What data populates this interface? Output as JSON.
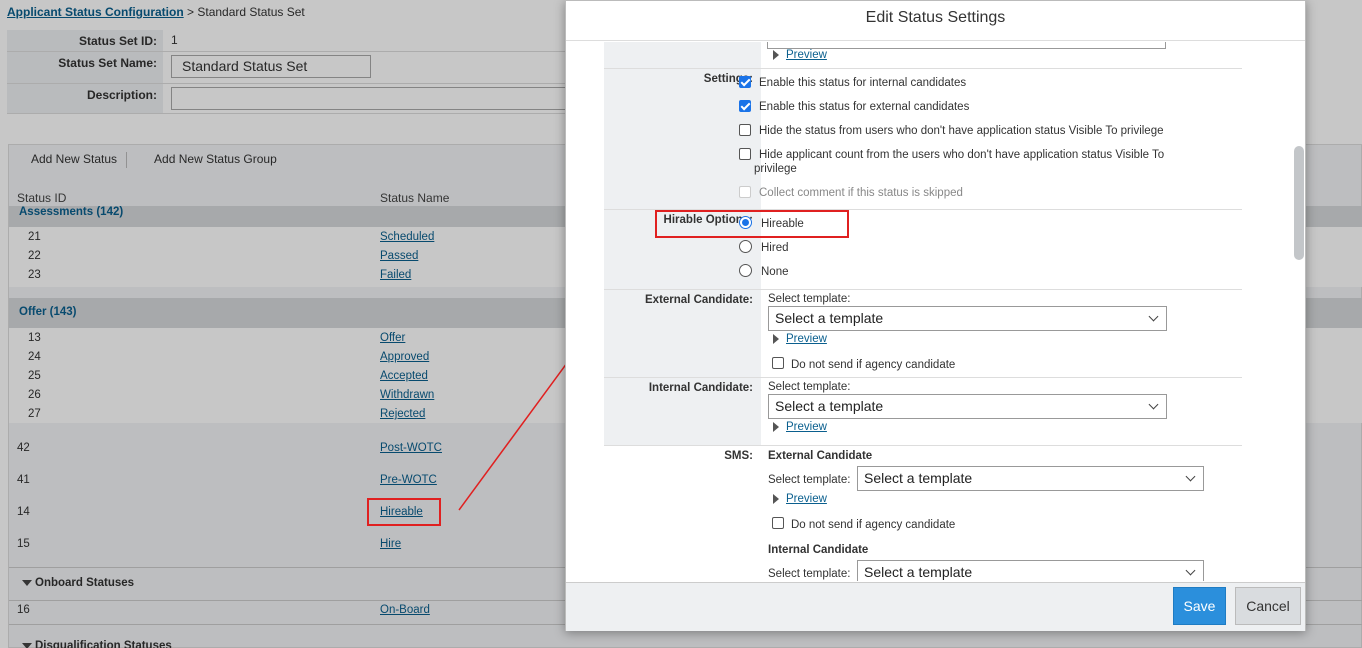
{
  "breadcrumb": {
    "link": "Applicant Status Configuration",
    "separator": " > ",
    "current": "Standard Status Set"
  },
  "status_set": {
    "id_label": "Status Set ID:",
    "id_value": "1",
    "name_label": "Status Set Name:",
    "name_value": "Standard Status Set",
    "desc_label": "Description:",
    "desc_value": ""
  },
  "toolbar": {
    "add_status": "Add New Status",
    "add_group": "Add New Status Group"
  },
  "columns": {
    "status_id": "Status ID",
    "status_name": "Status Name"
  },
  "groups": {
    "assessments": {
      "title": "Assessments (142)",
      "rows": [
        {
          "id": "21",
          "name": "Scheduled"
        },
        {
          "id": "22",
          "name": "Passed"
        },
        {
          "id": "23",
          "name": "Failed"
        }
      ]
    },
    "offer": {
      "title": "Offer (143)",
      "rows": [
        {
          "id": "13",
          "name": "Offer"
        },
        {
          "id": "24",
          "name": "Approved"
        },
        {
          "id": "25",
          "name": "Accepted"
        },
        {
          "id": "26",
          "name": "Withdrawn"
        },
        {
          "id": "27",
          "name": "Rejected"
        }
      ]
    }
  },
  "standalone_rows": [
    {
      "id": "42",
      "name": "Post-WOTC"
    },
    {
      "id": "41",
      "name": "Pre-WOTC"
    },
    {
      "id": "14",
      "name": "Hireable"
    },
    {
      "id": "15",
      "name": "Hire"
    }
  ],
  "onboard": {
    "title": "Onboard Statuses",
    "rows": [
      {
        "id": "16",
        "name": "On-Board"
      }
    ]
  },
  "disqualification": {
    "title": "Disqualification Statuses"
  },
  "modal": {
    "title": "Edit Status Settings",
    "preview_label": "Preview",
    "settings": {
      "label": "Settings:",
      "options": [
        {
          "text": "Enable this status for internal candidates",
          "checked": true
        },
        {
          "text": "Enable this status for external candidates",
          "checked": true
        },
        {
          "text": "Hide the status from users who don't have application status Visible To privilege",
          "checked": false
        },
        {
          "text": "Hide applicant count from the users who don't have application status Visible To",
          "cont": "privilege",
          "checked": false
        },
        {
          "text": "Collect comment if this status is skipped",
          "checked": false,
          "disabled": true
        }
      ]
    },
    "hirable": {
      "label": "Hirable Options:",
      "options": [
        "Hireable",
        "Hired",
        "None"
      ],
      "selected": "Hireable"
    },
    "external": {
      "label": "External Candidate:",
      "select_label": "Select template:",
      "select_value": "Select a template",
      "agency": "Do not send if agency candidate"
    },
    "internal": {
      "label": "Internal Candidate:",
      "select_label": "Select template:",
      "select_value": "Select a template"
    },
    "sms": {
      "label": "SMS:",
      "external_title": "External Candidate",
      "select_label": "Select template:",
      "select_value": "Select a template",
      "agency": "Do not send if agency candidate",
      "internal_title": "Internal Candidate"
    },
    "buttons": {
      "save": "Save",
      "cancel": "Cancel"
    }
  },
  "colors": {
    "accent": "#2b8fdc",
    "link": "#0a5f8e",
    "highlight": "#e02020"
  }
}
